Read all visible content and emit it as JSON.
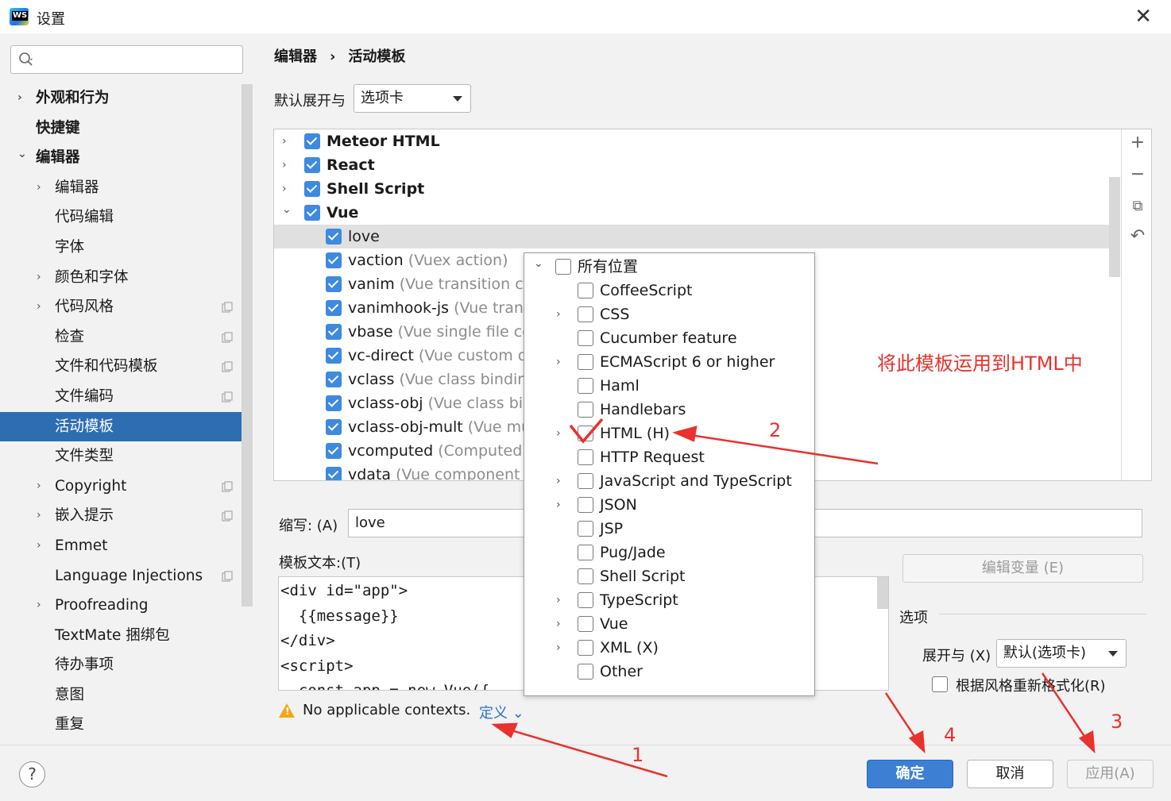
{
  "window": {
    "title": "设置",
    "close_icon": "✕"
  },
  "sidebar": {
    "search_placeholder": "",
    "items": [
      {
        "label": "外观和行为",
        "level": 0,
        "arrow": "›",
        "bold": true
      },
      {
        "label": "快捷键",
        "level": 0,
        "arrow": "",
        "bold": true
      },
      {
        "label": "编辑器",
        "level": 0,
        "arrow": "⌄",
        "bold": true
      },
      {
        "label": "编辑器",
        "level": 1,
        "arrow": "›"
      },
      {
        "label": "代码编辑",
        "level": 1,
        "arrow": ""
      },
      {
        "label": "字体",
        "level": 1,
        "arrow": ""
      },
      {
        "label": "颜色和字体",
        "level": 1,
        "arrow": "›"
      },
      {
        "label": "代码风格",
        "level": 1,
        "arrow": "›",
        "copy": true
      },
      {
        "label": "检查",
        "level": 1,
        "arrow": "",
        "copy": true
      },
      {
        "label": "文件和代码模板",
        "level": 1,
        "arrow": "",
        "copy": true
      },
      {
        "label": "文件编码",
        "level": 1,
        "arrow": "",
        "copy": true
      },
      {
        "label": "活动模板",
        "level": 1,
        "arrow": "",
        "selected": true
      },
      {
        "label": "文件类型",
        "level": 1,
        "arrow": ""
      },
      {
        "label": "Copyright",
        "level": 1,
        "arrow": "›",
        "copy": true
      },
      {
        "label": "嵌入提示",
        "level": 1,
        "arrow": "›",
        "copy": true
      },
      {
        "label": "Emmet",
        "level": 1,
        "arrow": "›"
      },
      {
        "label": "Language Injections",
        "level": 1,
        "arrow": "",
        "copy": true
      },
      {
        "label": "Proofreading",
        "level": 1,
        "arrow": "›"
      },
      {
        "label": "TextMate 捆绑包",
        "level": 1,
        "arrow": ""
      },
      {
        "label": "待办事项",
        "level": 1,
        "arrow": ""
      },
      {
        "label": "意图",
        "level": 1,
        "arrow": ""
      },
      {
        "label": "重复",
        "level": 1,
        "arrow": ""
      }
    ]
  },
  "breadcrumb": {
    "part1": "编辑器",
    "separator": "›",
    "part2": "活动模板"
  },
  "expand_with": {
    "label": "默认展开与",
    "value": "选项卡"
  },
  "template_list": {
    "rows": [
      {
        "arrow": "›",
        "name": "Meteor HTML",
        "desc": "",
        "checked": true,
        "group": true
      },
      {
        "arrow": "›",
        "name": "React",
        "desc": "",
        "checked": true,
        "group": true
      },
      {
        "arrow": "›",
        "name": "Shell Script",
        "desc": "",
        "checked": true,
        "group": true
      },
      {
        "arrow": "⌄",
        "name": "Vue",
        "desc": "",
        "checked": true,
        "group": true
      },
      {
        "arrow": "",
        "name": "love",
        "desc": "",
        "checked": true,
        "selected": true
      },
      {
        "arrow": "",
        "name": "vaction",
        "desc": "(Vuex action)",
        "checked": true
      },
      {
        "arrow": "",
        "name": "vanim",
        "desc": "(Vue transition com",
        "checked": true
      },
      {
        "arrow": "",
        "name": "vanimhook-js",
        "desc": "(Vue transit",
        "checked": true
      },
      {
        "arrow": "",
        "name": "vbase",
        "desc": "(Vue single file com",
        "checked": true
      },
      {
        "arrow": "",
        "name": "vc-direct",
        "desc": "(Vue custom dire",
        "checked": true
      },
      {
        "arrow": "",
        "name": "vclass",
        "desc": "(Vue class binding)",
        "checked": true
      },
      {
        "arrow": "",
        "name": "vclass-obj",
        "desc": "(Vue class bind",
        "checked": true
      },
      {
        "arrow": "",
        "name": "vclass-obj-mult",
        "desc": "(Vue mult",
        "checked": true
      },
      {
        "arrow": "",
        "name": "vcomputed",
        "desc": "(Computed va",
        "checked": true
      },
      {
        "arrow": "",
        "name": "vdata",
        "desc": "(Vue component da",
        "checked": true
      }
    ],
    "side_buttons": {
      "add": "+",
      "remove": "−",
      "copy": "⧉",
      "revert": "↶"
    }
  },
  "abbreviation": {
    "label": "缩写: (A)",
    "value": "love"
  },
  "template_text": {
    "label": "模板文本:(T)",
    "lines": [
      "<div id=\"app\">",
      "  {{message}}",
      "</div>",
      "<script>",
      "  const app = new Vue({"
    ]
  },
  "warning": {
    "text": "No applicable contexts.",
    "link": "定义 ⌄"
  },
  "edit_variables": "编辑变量 (E)",
  "options": {
    "label": "选项",
    "expand_label": "展开与 (X)",
    "expand_value": "默认(选项卡)",
    "reformat_label": "根据风格重新格式化(R)"
  },
  "context_popup": {
    "rows": [
      {
        "arrow": "⌄",
        "label": "所有位置",
        "indent": 0
      },
      {
        "arrow": "",
        "label": "CoffeeScript",
        "indent": 1
      },
      {
        "arrow": "›",
        "label": "CSS",
        "indent": 1
      },
      {
        "arrow": "",
        "label": "Cucumber feature",
        "indent": 1
      },
      {
        "arrow": "›",
        "label": "ECMAScript 6 or higher",
        "indent": 1
      },
      {
        "arrow": "",
        "label": "Haml",
        "indent": 1
      },
      {
        "arrow": "",
        "label": "Handlebars",
        "indent": 1
      },
      {
        "arrow": "›",
        "label": "HTML (H)",
        "indent": 1
      },
      {
        "arrow": "",
        "label": "HTTP Request",
        "indent": 1
      },
      {
        "arrow": "›",
        "label": "JavaScript and TypeScript",
        "indent": 1
      },
      {
        "arrow": "›",
        "label": "JSON",
        "indent": 1
      },
      {
        "arrow": "",
        "label": "JSP",
        "indent": 1
      },
      {
        "arrow": "",
        "label": "Pug/Jade",
        "indent": 1
      },
      {
        "arrow": "",
        "label": "Shell Script",
        "indent": 1
      },
      {
        "arrow": "›",
        "label": "TypeScript",
        "indent": 1
      },
      {
        "arrow": "›",
        "label": "Vue",
        "indent": 1
      },
      {
        "arrow": "›",
        "label": "XML (X)",
        "indent": 1
      },
      {
        "arrow": "",
        "label": "Other",
        "indent": 1
      }
    ]
  },
  "buttons": {
    "help": "?",
    "ok": "确定",
    "cancel": "取消",
    "apply": "应用(A)"
  },
  "annotations": {
    "note": "将此模板运用到HTML中",
    "n1": "1",
    "n2": "2",
    "n3": "3",
    "n4": "4",
    "color": "#e8322e"
  },
  "colors": {
    "accent": "#2f6db3",
    "checkbox": "#3d8ae0",
    "link": "#2e6fc6"
  }
}
